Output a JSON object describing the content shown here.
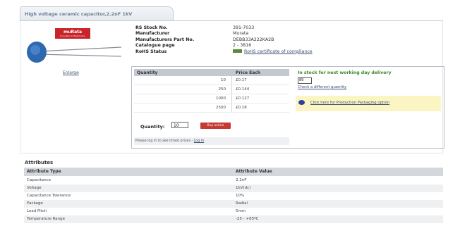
{
  "tab": {
    "title": "High voltage ceramic capacitor,2.2nF 1kV"
  },
  "brand": {
    "name": "muRata",
    "tagline": "Innovator in Electronics"
  },
  "enlarge_label": "Enlarge",
  "spec": {
    "labels": [
      "RS Stock No.",
      "Manufacturer",
      "Manufacturers Part No.",
      "Catalogue page",
      "RoHS Status"
    ],
    "values": [
      "391-7033",
      "Murata",
      "DEBB33A222KA2B",
      "2 - 3816",
      ""
    ],
    "rohs_link": "RoHS certificate of compliance"
  },
  "price_table": {
    "header_qty": "Quantity",
    "header_price": "Price Each",
    "rows": [
      {
        "qty": "10",
        "price": "£0.17"
      },
      {
        "qty": "250",
        "price": "£0.144"
      },
      {
        "qty": "1000",
        "price": "£0.127"
      },
      {
        "qty": "2500",
        "price": "£0.18"
      }
    ]
  },
  "quantity": {
    "label": "Quantity:",
    "value": "10",
    "button": "Buy online"
  },
  "login": {
    "text": "Please log in to see timed prices - ",
    "link": "Log in"
  },
  "stock": {
    "text": "In stock for next working day delivery",
    "value": "89",
    "other_qty_link": "Check a different quantity"
  },
  "promo": {
    "text": "Click here for Production Packaging option"
  },
  "attributes": {
    "title": "Attributes",
    "header_type": "Attribute Type",
    "header_value": "Attribute Value",
    "rows": [
      {
        "type": "Capacitance",
        "value": "2.2nF"
      },
      {
        "type": "Voltage",
        "value": "1kV(dc)"
      },
      {
        "type": "Capacitance Tolerance",
        "value": "10%"
      },
      {
        "type": "Package",
        "value": "Radial"
      },
      {
        "type": "Lead Pitch",
        "value": "5mm"
      },
      {
        "type": "Temperature Range",
        "value": "-25 - +85ºC"
      }
    ]
  },
  "colors": {
    "accent": "#c53a32",
    "link": "#3c4f6f",
    "stock": "#3a8a2a",
    "promo_bg": "#fbf5c3"
  }
}
